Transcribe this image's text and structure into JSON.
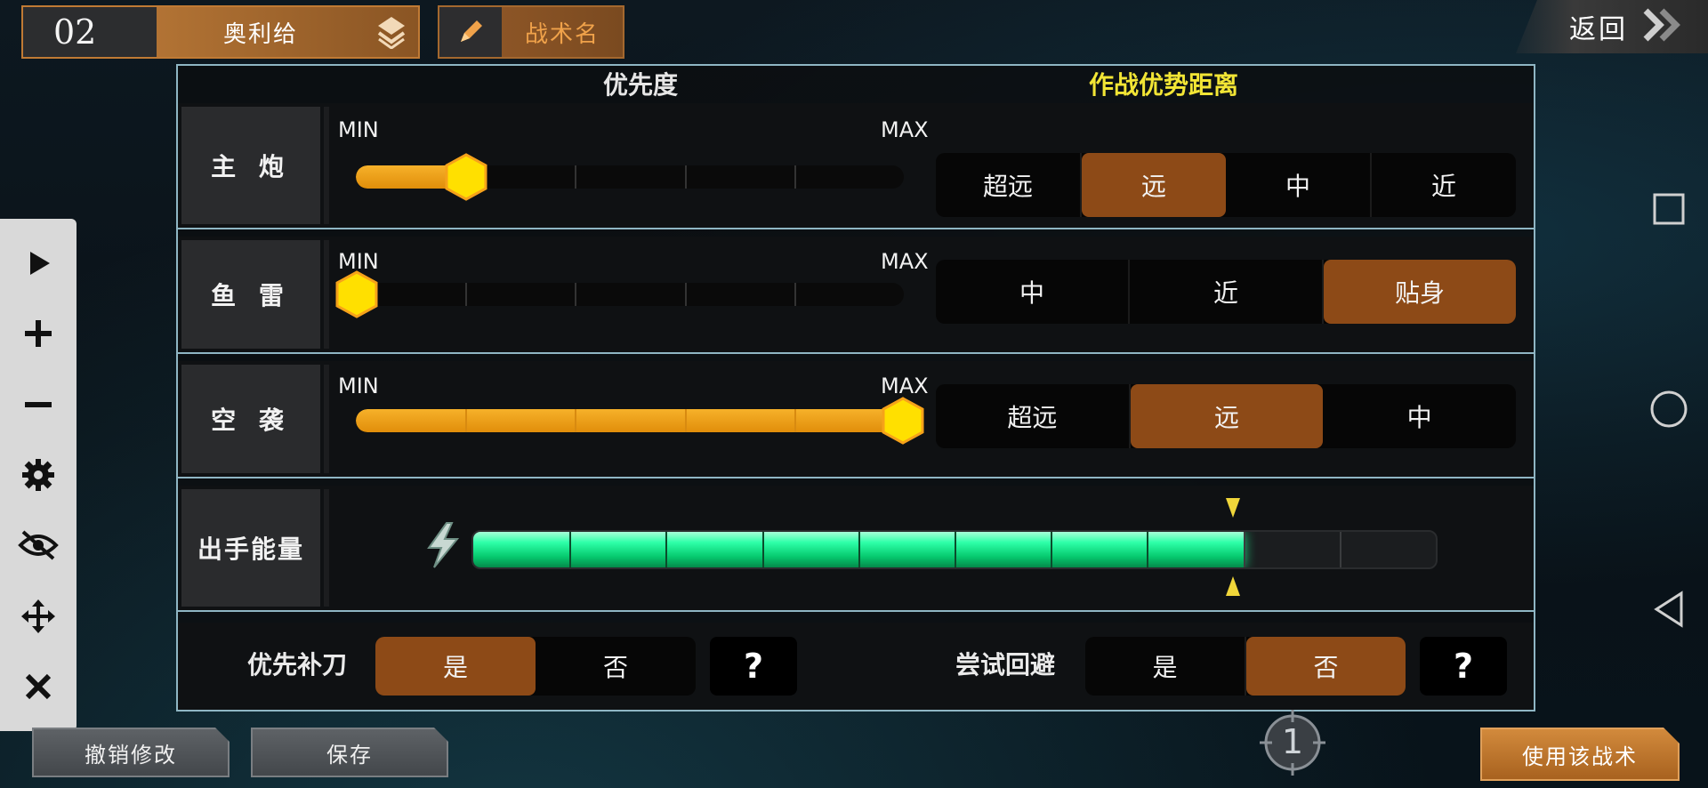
{
  "header": {
    "ship_number": "02",
    "ship_name": "奥利给",
    "tactic_label": "战术名",
    "back_label": "返回"
  },
  "panel": {
    "priority_header": "优先度",
    "distance_header": "作战优势距离",
    "min_label": "MIN",
    "max_label": "MAX",
    "rows": [
      {
        "label": "主 炮",
        "priority": 0.2,
        "options": [
          "超远",
          "远",
          "中",
          "近"
        ],
        "selected": "远"
      },
      {
        "label": "鱼 雷",
        "priority": 0.0,
        "options": [
          "中",
          "近",
          "贴身"
        ],
        "selected": "贴身"
      },
      {
        "label": "空 袭",
        "priority": 1.0,
        "options": [
          "超远",
          "远",
          "中"
        ],
        "selected": "远"
      }
    ],
    "energy": {
      "label": "出手能量",
      "level": 8,
      "max": 10
    },
    "toggles": [
      {
        "label": "优先补刀",
        "yes": "是",
        "no": "否",
        "selected": "是",
        "help": "?"
      },
      {
        "label": "尝试回避",
        "yes": "是",
        "no": "否",
        "selected": "否",
        "help": "?"
      }
    ]
  },
  "toolbar": {
    "icons": [
      "play-icon",
      "plus-icon",
      "minus-icon",
      "gear-icon",
      "eye-off-icon",
      "move-icon",
      "close-icon"
    ]
  },
  "footer": {
    "undo_label": "撤销修改",
    "save_label": "保存",
    "use_label": "使用该战术",
    "page_number": "1"
  },
  "colors": {
    "accent_orange": "#8d4a17",
    "energy_green": "#2dffa8",
    "slider_gold": "#f6b12a",
    "distance_header_yellow": "#f2e535"
  }
}
